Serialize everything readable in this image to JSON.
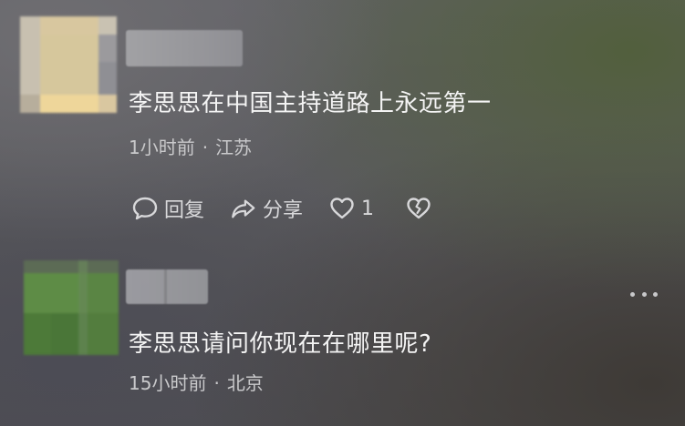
{
  "comments": [
    {
      "text": "李思思在中国主持道路上永远第一",
      "time": "1小时前",
      "separator": "·",
      "location": "江苏",
      "actions": {
        "reply_label": "回复",
        "share_label": "分享",
        "like_count": "1"
      }
    },
    {
      "text": "李思思请问你现在在哪里呢?",
      "time": "15小时前",
      "separator": "·",
      "location": "北京"
    }
  ],
  "icons": {
    "reply": "comment-bubble-icon",
    "share": "share-arrow-icon",
    "like": "heart-outline-icon",
    "dislike": "broken-heart-icon",
    "more": "more-dots-icon"
  },
  "colors": {
    "text_primary": "#f4f4f4",
    "text_secondary": "#c9c9cb",
    "icon": "#d8d8da"
  }
}
